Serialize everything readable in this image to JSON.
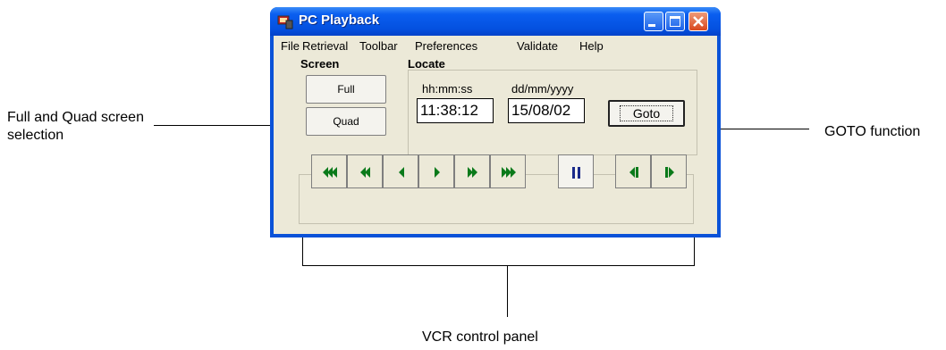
{
  "annotations": {
    "left": "Full and Quad screen selection",
    "right": "GOTO function",
    "bottom": "VCR control panel"
  },
  "window": {
    "title": "PC Playback",
    "icon": "pc-playback-icon"
  },
  "menu": [
    "File",
    "Retrieval",
    "Toolbar",
    "Preferences",
    "Validate",
    "Help"
  ],
  "screen": {
    "label": "Screen",
    "full_label": "Full",
    "quad_label": "Quad"
  },
  "locate": {
    "label": "Locate",
    "time_format": "hh:mm:ss",
    "date_format": "dd/mm/yyyy",
    "time_value": "11:38:12",
    "date_value": "15/08/02",
    "goto_label": "Goto"
  },
  "vcr": {
    "buttons": [
      "rewind-fast-icon",
      "rewind-icon",
      "step-back-icon",
      "play-icon",
      "fast-forward-icon",
      "fast-forward-max-icon",
      "pause-icon",
      "frame-back-icon",
      "frame-forward-icon"
    ],
    "color": "#0a7a1a"
  }
}
